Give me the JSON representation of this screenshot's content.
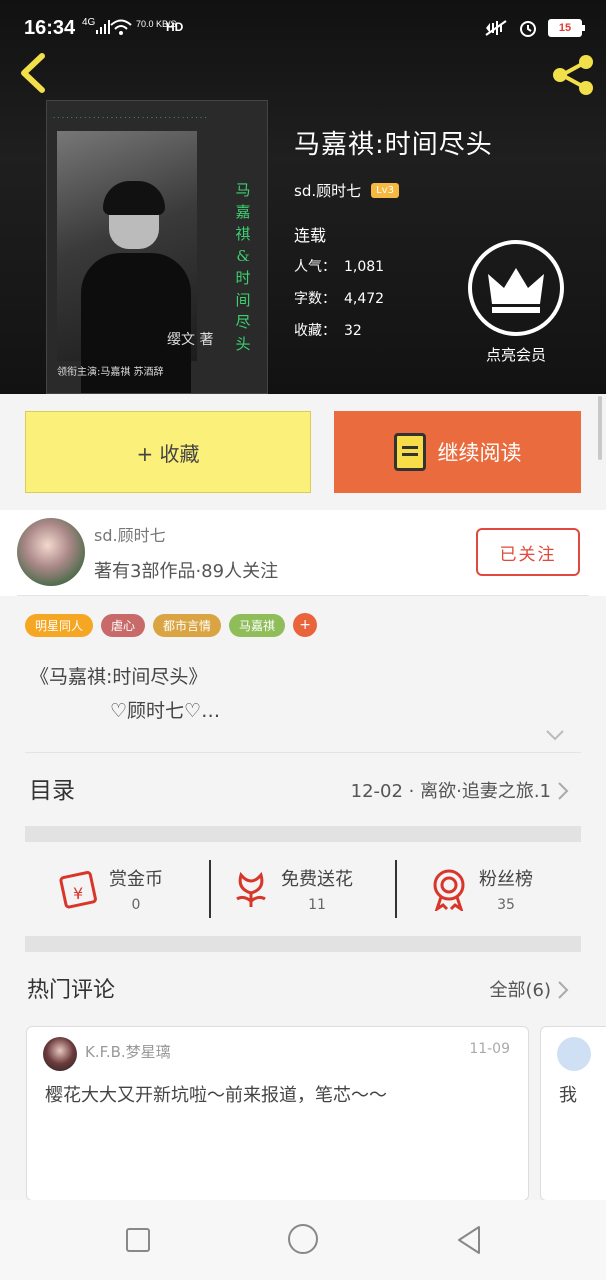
{
  "status_bar": {
    "time": "16:34",
    "network": "4G",
    "speed": "70.0 KB/S",
    "hd": "HD",
    "battery": "15"
  },
  "header": {
    "back_icon": "back-chevron-icon",
    "share_icon": "share-icon"
  },
  "cover": {
    "vertical_title": [
      "马",
      "嘉",
      "祺",
      "&",
      "时",
      "间",
      "尽",
      "头"
    ],
    "author_mark": "缨文 著",
    "cast_line": "领衔主演:马嘉祺 苏酒辞"
  },
  "book": {
    "title": "马嘉祺:时间尽头",
    "author": "sd.顾时七",
    "level": "Lv3",
    "status": "连载",
    "stats": [
      {
        "label": "人气：",
        "value": "1,081"
      },
      {
        "label": "字数：",
        "value": "4,472"
      },
      {
        "label": "收藏：",
        "value": "32"
      }
    ],
    "vip_label": "点亮会员"
  },
  "buttons": {
    "favorite": "+ 收藏",
    "continue_reading": "继续阅读"
  },
  "author_section": {
    "name": "sd.顾时七",
    "summary": "著有3部作品·89人关注",
    "follow": "已关注"
  },
  "tags": [
    {
      "label": "明星同人",
      "color": "#f5a623"
    },
    {
      "label": "虐心",
      "color": "#c96a6a"
    },
    {
      "label": "都市言情",
      "color": "#d9a441"
    },
    {
      "label": "马嘉祺",
      "color": "#8fbd59"
    }
  ],
  "tag_add": "+",
  "description": {
    "line1": "《马嘉祺:时间尽头》",
    "line2": "♡顾时七♡…"
  },
  "toc": {
    "heading": "目录",
    "latest": "12-02 · 离欲·追妻之旅.1"
  },
  "actions": [
    {
      "label": "赏金币",
      "value": "0",
      "icon": "red-envelope-icon"
    },
    {
      "label": "免费送花",
      "value": "11",
      "icon": "flower-icon"
    },
    {
      "label": "粉丝榜",
      "value": "35",
      "icon": "medal-icon"
    }
  ],
  "comments": {
    "heading": "热门评论",
    "all": "全部(6)",
    "items": [
      {
        "user": "K.F.B.梦星璃",
        "date": "11-09",
        "text": "樱花大大又开新坑啦～前来报道，笔芯～～"
      },
      {
        "text": "我"
      }
    ]
  },
  "colors": {
    "accent_orange": "#ea6b3d",
    "favorite_yellow": "#fbf17a",
    "follow_red": "#e04a3c"
  }
}
